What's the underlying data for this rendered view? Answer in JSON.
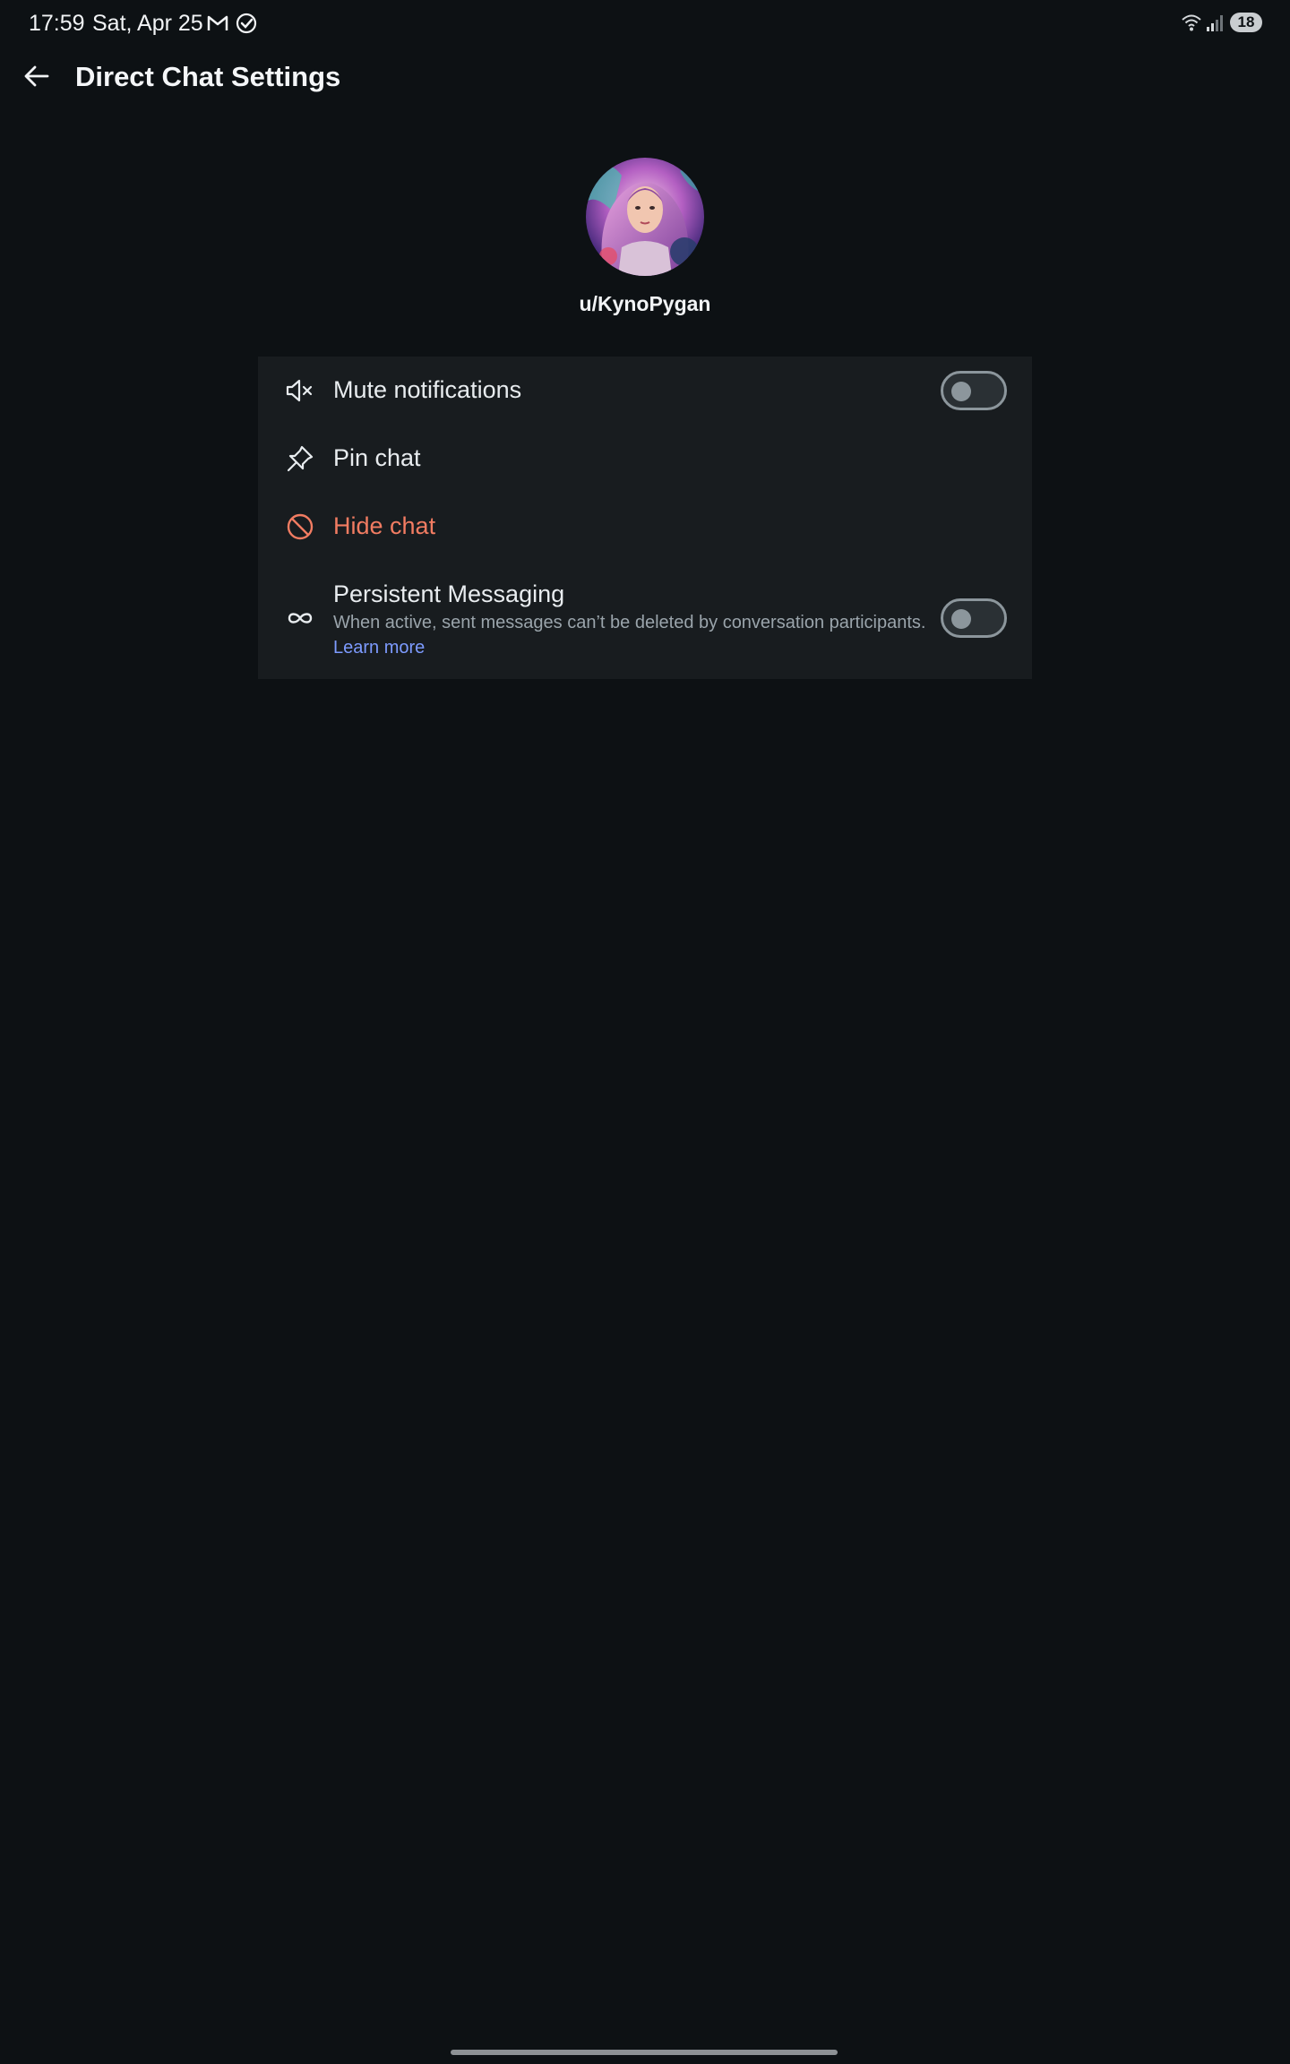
{
  "status_bar": {
    "time": "17:59",
    "date": "Sat, Apr 25",
    "notification_icons": [
      "gmail-icon",
      "check-circle-icon"
    ],
    "battery": "18"
  },
  "header": {
    "title": "Direct Chat Settings"
  },
  "profile": {
    "username": "u/KynoPygan"
  },
  "settings": {
    "mute": {
      "label": "Mute notifications",
      "enabled": false
    },
    "pin": {
      "label": "Pin chat"
    },
    "hide": {
      "label": "Hide chat",
      "color": "#f27c62"
    },
    "persistent": {
      "label": "Persistent Messaging",
      "description": "When active, sent messages can’t be deleted by conversation participants.",
      "link": "Learn more",
      "enabled": false
    }
  },
  "colors": {
    "background": "#0d1114",
    "card": "#181c1f",
    "link": "#7d9bff",
    "danger": "#f27c62"
  }
}
